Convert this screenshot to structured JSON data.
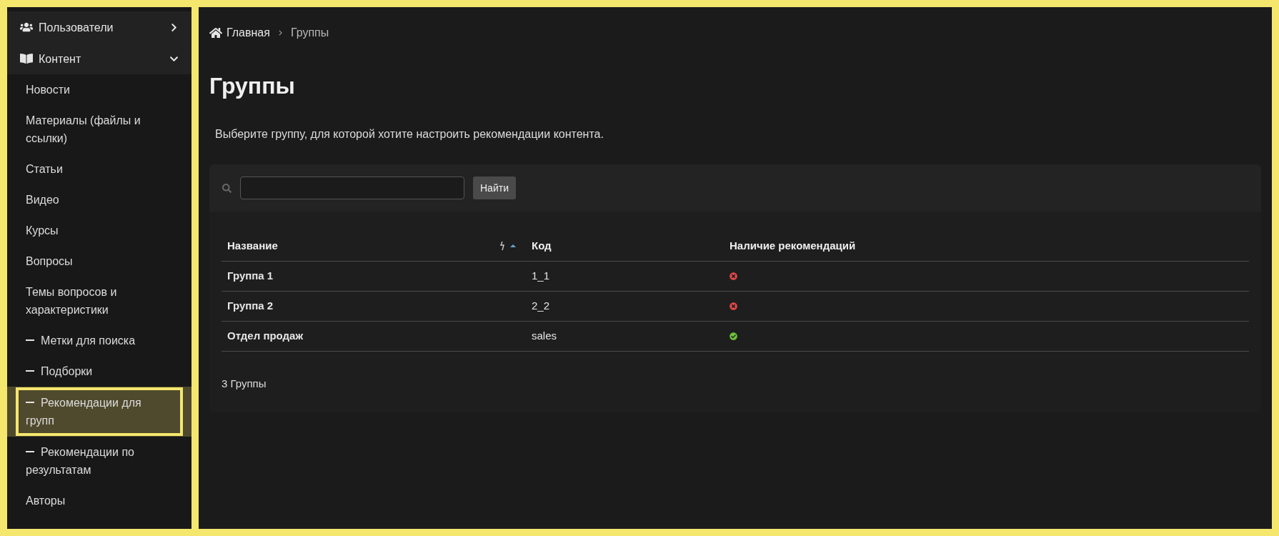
{
  "sidebar": {
    "items": [
      {
        "kind": "group",
        "label": "Пользователи",
        "expanded": false,
        "selected": false
      },
      {
        "kind": "group",
        "label": "Контент",
        "expanded": true,
        "selected": false
      },
      {
        "kind": "link",
        "label": "Новости",
        "selected": false
      },
      {
        "kind": "link",
        "label": "Материалы (файлы и ссылки)",
        "selected": false
      },
      {
        "kind": "link",
        "label": "Статьи",
        "selected": false
      },
      {
        "kind": "link",
        "label": "Видео",
        "selected": false
      },
      {
        "kind": "link",
        "label": "Курсы",
        "selected": false
      },
      {
        "kind": "link",
        "label": "Вопросы",
        "selected": false
      },
      {
        "kind": "link",
        "label": "Темы вопросов и характеристики",
        "selected": false
      },
      {
        "kind": "sub",
        "label": "Метки для поиска",
        "selected": false
      },
      {
        "kind": "sub",
        "label": "Подборки",
        "selected": false
      },
      {
        "kind": "sub",
        "label": "Рекомендации для групп",
        "selected": true
      },
      {
        "kind": "sub",
        "label": "Рекомендации по результатам",
        "selected": false
      },
      {
        "kind": "link",
        "label": "Авторы",
        "selected": false
      }
    ]
  },
  "breadcrumb": [
    "Главная",
    "Группы"
  ],
  "title": "Группы",
  "description": "Выберите группу, для которой хотите настроить рекомендации контента.",
  "search": {
    "button": "Найти"
  },
  "table": {
    "columns": [
      {
        "label": "Название",
        "sorted": true
      },
      {
        "label": "Код",
        "sorted": false
      },
      {
        "label": "Наличие рекомендаций",
        "sorted": false
      }
    ],
    "rows": [
      {
        "name": "Группа 1",
        "code": "1_1",
        "has_recommendations": false
      },
      {
        "name": "Группа 2",
        "code": "2_2",
        "has_recommendations": false
      },
      {
        "name": "Отдел продаж",
        "code": "sales",
        "has_recommendations": true
      }
    ],
    "footer": "3 Группы"
  }
}
